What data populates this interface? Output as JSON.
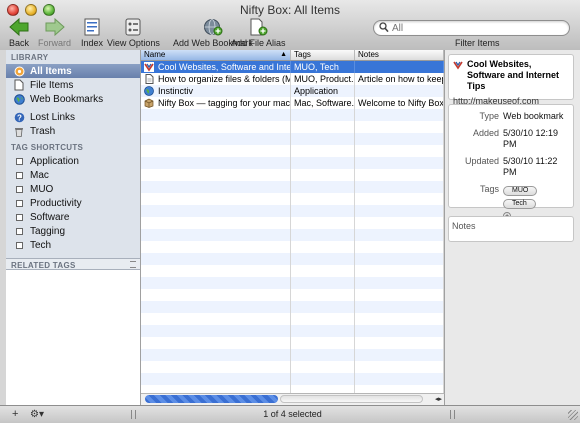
{
  "window": {
    "title": "Nifty Box: All Items"
  },
  "toolbar": {
    "back": "Back",
    "forward": "Forward",
    "index": "Index",
    "view_options": "View Options",
    "add_web_bookmark": "Add Web Bookmark",
    "add_file_alias": "Add File Alias",
    "filter_items": "Filter Items"
  },
  "search": {
    "placeholder": "All",
    "value": ""
  },
  "sidebar": {
    "library_header": "LIBRARY",
    "library": [
      {
        "label": "All Items",
        "icon": "all-items-icon"
      },
      {
        "label": "File Items",
        "icon": "file-icon"
      },
      {
        "label": "Web Bookmarks",
        "icon": "globe-icon"
      }
    ],
    "other": [
      {
        "label": "Lost Links",
        "icon": "question-icon"
      },
      {
        "label": "Trash",
        "icon": "trash-icon"
      }
    ],
    "tag_header": "TAG SHORTCUTS",
    "tags": [
      {
        "label": "Application"
      },
      {
        "label": "Mac"
      },
      {
        "label": "MUO"
      },
      {
        "label": "Productivity"
      },
      {
        "label": "Software"
      },
      {
        "label": "Tagging"
      },
      {
        "label": "Tech"
      }
    ],
    "related_header": "RELATED TAGS"
  },
  "table": {
    "columns": [
      "Name",
      "Tags",
      "Notes"
    ],
    "rows": [
      {
        "name": "Cool Websites, Software and Inte...",
        "tags": "MUO, Tech",
        "notes": "",
        "icon": "bookmark-icon"
      },
      {
        "name": "How to organize files & folders (Mac)",
        "tags": "MUO, Product...",
        "notes": "Article on how to keep...",
        "icon": "document-icon"
      },
      {
        "name": "Instinctiv",
        "tags": "Application",
        "notes": "",
        "icon": "globe-icon"
      },
      {
        "name": "Nifty Box — tagging for your mac",
        "tags": "Mac, Software...",
        "notes": "Welcome to Nifty Box!",
        "icon": "box-icon"
      }
    ]
  },
  "status": {
    "selection": "1 of 4 selected"
  },
  "inspector": {
    "title": "Cool Websites, Software and Internet Tips",
    "url": "http://makeuseof.com",
    "type_label": "Type",
    "type_value": "Web bookmark",
    "added_label": "Added",
    "added_value": "5/30/10 12:19 PM",
    "updated_label": "Updated",
    "updated_value": "5/30/10 11:22 PM",
    "tags_label": "Tags",
    "tags": [
      "MUO",
      "Tech"
    ],
    "notes_label": "Notes"
  },
  "bottom": {
    "add": "+",
    "action": "⚙▾"
  },
  "colors": {
    "selection": "#3875d7",
    "sidebar_selected": "#6f86b2",
    "sidebar_bg": "#dde3eb"
  }
}
